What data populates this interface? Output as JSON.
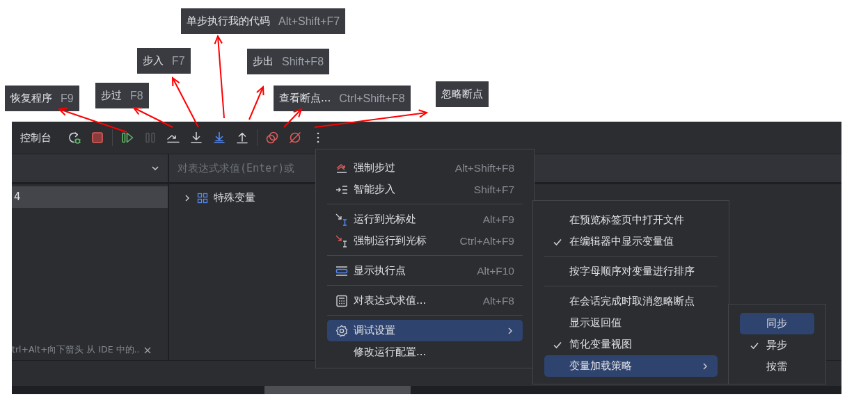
{
  "callouts": [
    {
      "label": "恢复程序",
      "shortcut": "F9"
    },
    {
      "label": "步过",
      "shortcut": "F8"
    },
    {
      "label": "步入",
      "shortcut": "F7"
    },
    {
      "label": "单步执行我的代码",
      "shortcut": "Alt+Shift+F7"
    },
    {
      "label": "步出",
      "shortcut": "Shift+F8"
    },
    {
      "label": "查看断点...",
      "shortcut": "Ctrl+Shift+F8"
    },
    {
      "label": "忽略断点"
    }
  ],
  "toolbar": {
    "title": "控制台",
    "buttons": [
      {
        "disabled": false
      },
      {
        "disabled": false
      },
      {
        "disabled": false
      },
      {
        "disabled": true
      },
      {
        "disabled": false
      },
      {
        "disabled": false
      },
      {
        "disabled": false
      },
      {
        "disabled": false
      },
      {
        "disabled": false
      },
      {
        "disabled": false
      },
      {
        "disabled": false
      }
    ]
  },
  "frames_panel": {
    "frames": [
      {
        "label": "4",
        "selected": true
      }
    ],
    "hint": "trl+Alt+向下箭头 从 IDE 中的.."
  },
  "variables_panel": {
    "expression_field": {
      "placeholder": "对表达式求值(Enter)或"
    },
    "tree": [
      {
        "label": "特殊变量",
        "expanded": false
      }
    ]
  },
  "more_menu": {
    "groups": [
      {
        "items": [
          {
            "label": "强制步过",
            "shortcut": "Alt+Shift+F8",
            "selected": false,
            "submenu": false
          },
          {
            "label": "智能步入",
            "shortcut": "Shift+F7",
            "selected": false,
            "submenu": false
          }
        ]
      },
      {
        "items": [
          {
            "label": "运行到光标处",
            "shortcut": "Alt+F9",
            "selected": false,
            "submenu": false
          },
          {
            "label": "强制运行到光标",
            "shortcut": "Ctrl+Alt+F9",
            "selected": false,
            "submenu": false
          }
        ]
      },
      {
        "items": [
          {
            "label": "显示执行点",
            "shortcut": "Alt+F10",
            "selected": false,
            "submenu": false
          }
        ]
      },
      {
        "items": [
          {
            "label": "对表达式求值...",
            "shortcut": "Alt+F8",
            "selected": false,
            "submenu": false
          }
        ]
      },
      {
        "items": [
          {
            "label": "调试设置",
            "selected": true,
            "submenu": true
          },
          {
            "label": "修改运行配置...",
            "selected": false,
            "submenu": false
          }
        ]
      }
    ]
  },
  "debug_settings_menu": {
    "groups": [
      {
        "items": [
          {
            "label": "在预览标签页中打开文件",
            "checked": false,
            "selected": false,
            "submenu": false
          },
          {
            "label": "在编辑器中显示变量值",
            "checked": true,
            "selected": false,
            "submenu": false
          }
        ]
      },
      {
        "items": [
          {
            "label": "按字母顺序对变量进行排序",
            "checked": false,
            "selected": false,
            "submenu": false
          }
        ]
      },
      {
        "items": [
          {
            "label": "在会话完成时取消忽略断点",
            "checked": false,
            "selected": false,
            "submenu": false
          },
          {
            "label": "显示返回值",
            "checked": false,
            "selected": false,
            "submenu": false
          },
          {
            "label": "简化变量视图",
            "checked": true,
            "selected": false,
            "submenu": false
          },
          {
            "label": "变量加载策略",
            "checked": false,
            "selected": true,
            "submenu": true
          }
        ]
      }
    ]
  },
  "loading_policy_menu": {
    "items": [
      {
        "label": "同步",
        "checked": false,
        "selected": true
      },
      {
        "label": "异步",
        "checked": true,
        "selected": false
      },
      {
        "label": "按需",
        "checked": false,
        "selected": false
      }
    ]
  }
}
